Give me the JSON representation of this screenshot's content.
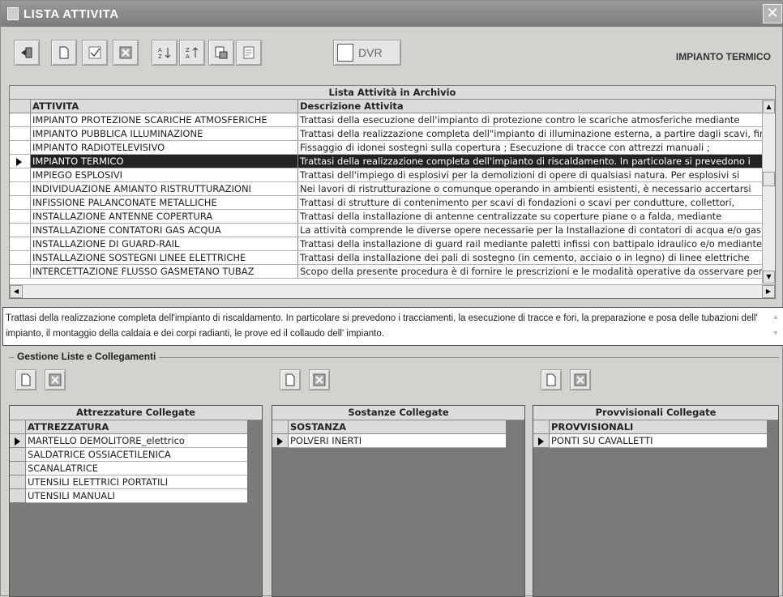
{
  "window": {
    "title": "LISTA ATTIVITA",
    "close_glyph": "✕"
  },
  "toolbar": {
    "buttons": [
      "exit-icon",
      "new-icon",
      "confirm-icon",
      "delete-icon",
      "sort-asc-icon",
      "sort-desc-icon",
      "preview-icon",
      "report-icon"
    ],
    "dvr_label": "DVR",
    "current_activity": "IMPIANTO TERMICO"
  },
  "main_grid": {
    "caption": "Lista Attività in Archivio",
    "columns": [
      "ATTIVITA",
      "Descrizione Attivita"
    ],
    "rows": [
      {
        "attivita": "IMPIANTO PROTEZIONE SCARICHE ATMOSFERICHE",
        "descrizione": "Trattasi della esecuzione dell'impianto di protezione contro le scariche atmosferiche mediante"
      },
      {
        "attivita": "IMPIANTO PUBBLICA ILLUMINAZIONE",
        "descrizione": "Trattasi della realizzazione completa dell\"impianto di illuminazione esterna, a partire dagli scavi, fino"
      },
      {
        "attivita": "IMPIANTO RADIOTELEVISIVO",
        "descrizione": "Fissaggio di idonei sostegni sulla copertura ; Esecuzione di tracce con attrezzi manuali ;"
      },
      {
        "attivita": "IMPIANTO TERMICO",
        "descrizione": "Trattasi della realizzazione completa dell'impianto di riscaldamento. In particolare si prevedono i"
      },
      {
        "attivita": "IMPIEGO ESPLOSIVI",
        "descrizione": "Trattasi dell'impiego di esplosivi per la demolizioni di opere di qualsiasi natura. Per esplosivi si"
      },
      {
        "attivita": "INDIVIDUAZIONE AMIANTO RISTRUTTURAZIONI",
        "descrizione": "Nei lavori di ristrutturazione o comunque operando in ambienti esistenti, è necessario accertarsi"
      },
      {
        "attivita": "INFISSIONE PALANCONATE METALLICHE",
        "descrizione": "Trattasi di strutture di contenimento per scavi di fondazioni o scavi per condutture, collettori,"
      },
      {
        "attivita": "INSTALLAZIONE ANTENNE COPERTURA",
        "descrizione": "Trattasi della installazione di antenne centralizzate su coperture piane o a falda, mediante"
      },
      {
        "attivita": "INSTALLAZIONE CONTATORI GAS ACQUA",
        "descrizione": "La attività comprende le diverse opere necessarie per la Installazione di contatori di acqua e/o gas."
      },
      {
        "attivita": "INSTALLAZIONE DI GUARD-RAIL",
        "descrizione": "Trattasi della installazione di guard rail mediante paletti infissi con battipalo idraulico e/o mediante"
      },
      {
        "attivita": "INSTALLAZIONE SOSTEGNI LINEE ELETTRICHE",
        "descrizione": "Trattasi della installazione dei pali di sostegno (in cemento, acciaio o in legno)  di linee elettriche"
      },
      {
        "attivita": "INTERCETTAZIONE FLUSSO GASMETANO TUBAZ",
        "descrizione": "Scopo della presente procedura è di fornire le prescrizioni e le modalità operative da osservare per"
      }
    ],
    "selected_index": 3
  },
  "description": {
    "text": "Trattasi della realizzazione completa dell'impianto di riscaldamento. In particolare si prevedono i tracciamenti, la esecuzione di  tracce e fori, la preparazione e posa delle tubazioni dell' impianto, il montaggio della caldaia e dei corpi radianti, le prove ed il collaudo dell' impianto."
  },
  "gestione": {
    "title": "Gestione Liste e Collegamenti"
  },
  "attrezzature": {
    "caption": "Attrezzature Collegate",
    "header": "ATTREZZATURA",
    "items": [
      "MARTELLO DEMOLITORE_elettrico",
      "SALDATRICE OSSIACETILENICA",
      "SCANALATRICE",
      "UTENSILI ELETTRICI PORTATILI",
      "UTENSILI MANUALI"
    ]
  },
  "sostanze": {
    "caption": "Sostanze Collegate",
    "header": "SOSTANZA",
    "items": [
      "POLVERI INERTI"
    ]
  },
  "provvisionali": {
    "caption": "Provvisionali Collegate",
    "header": "PROVVISIONALI",
    "items": [
      "PONTI SU CAVALLETTI"
    ]
  }
}
